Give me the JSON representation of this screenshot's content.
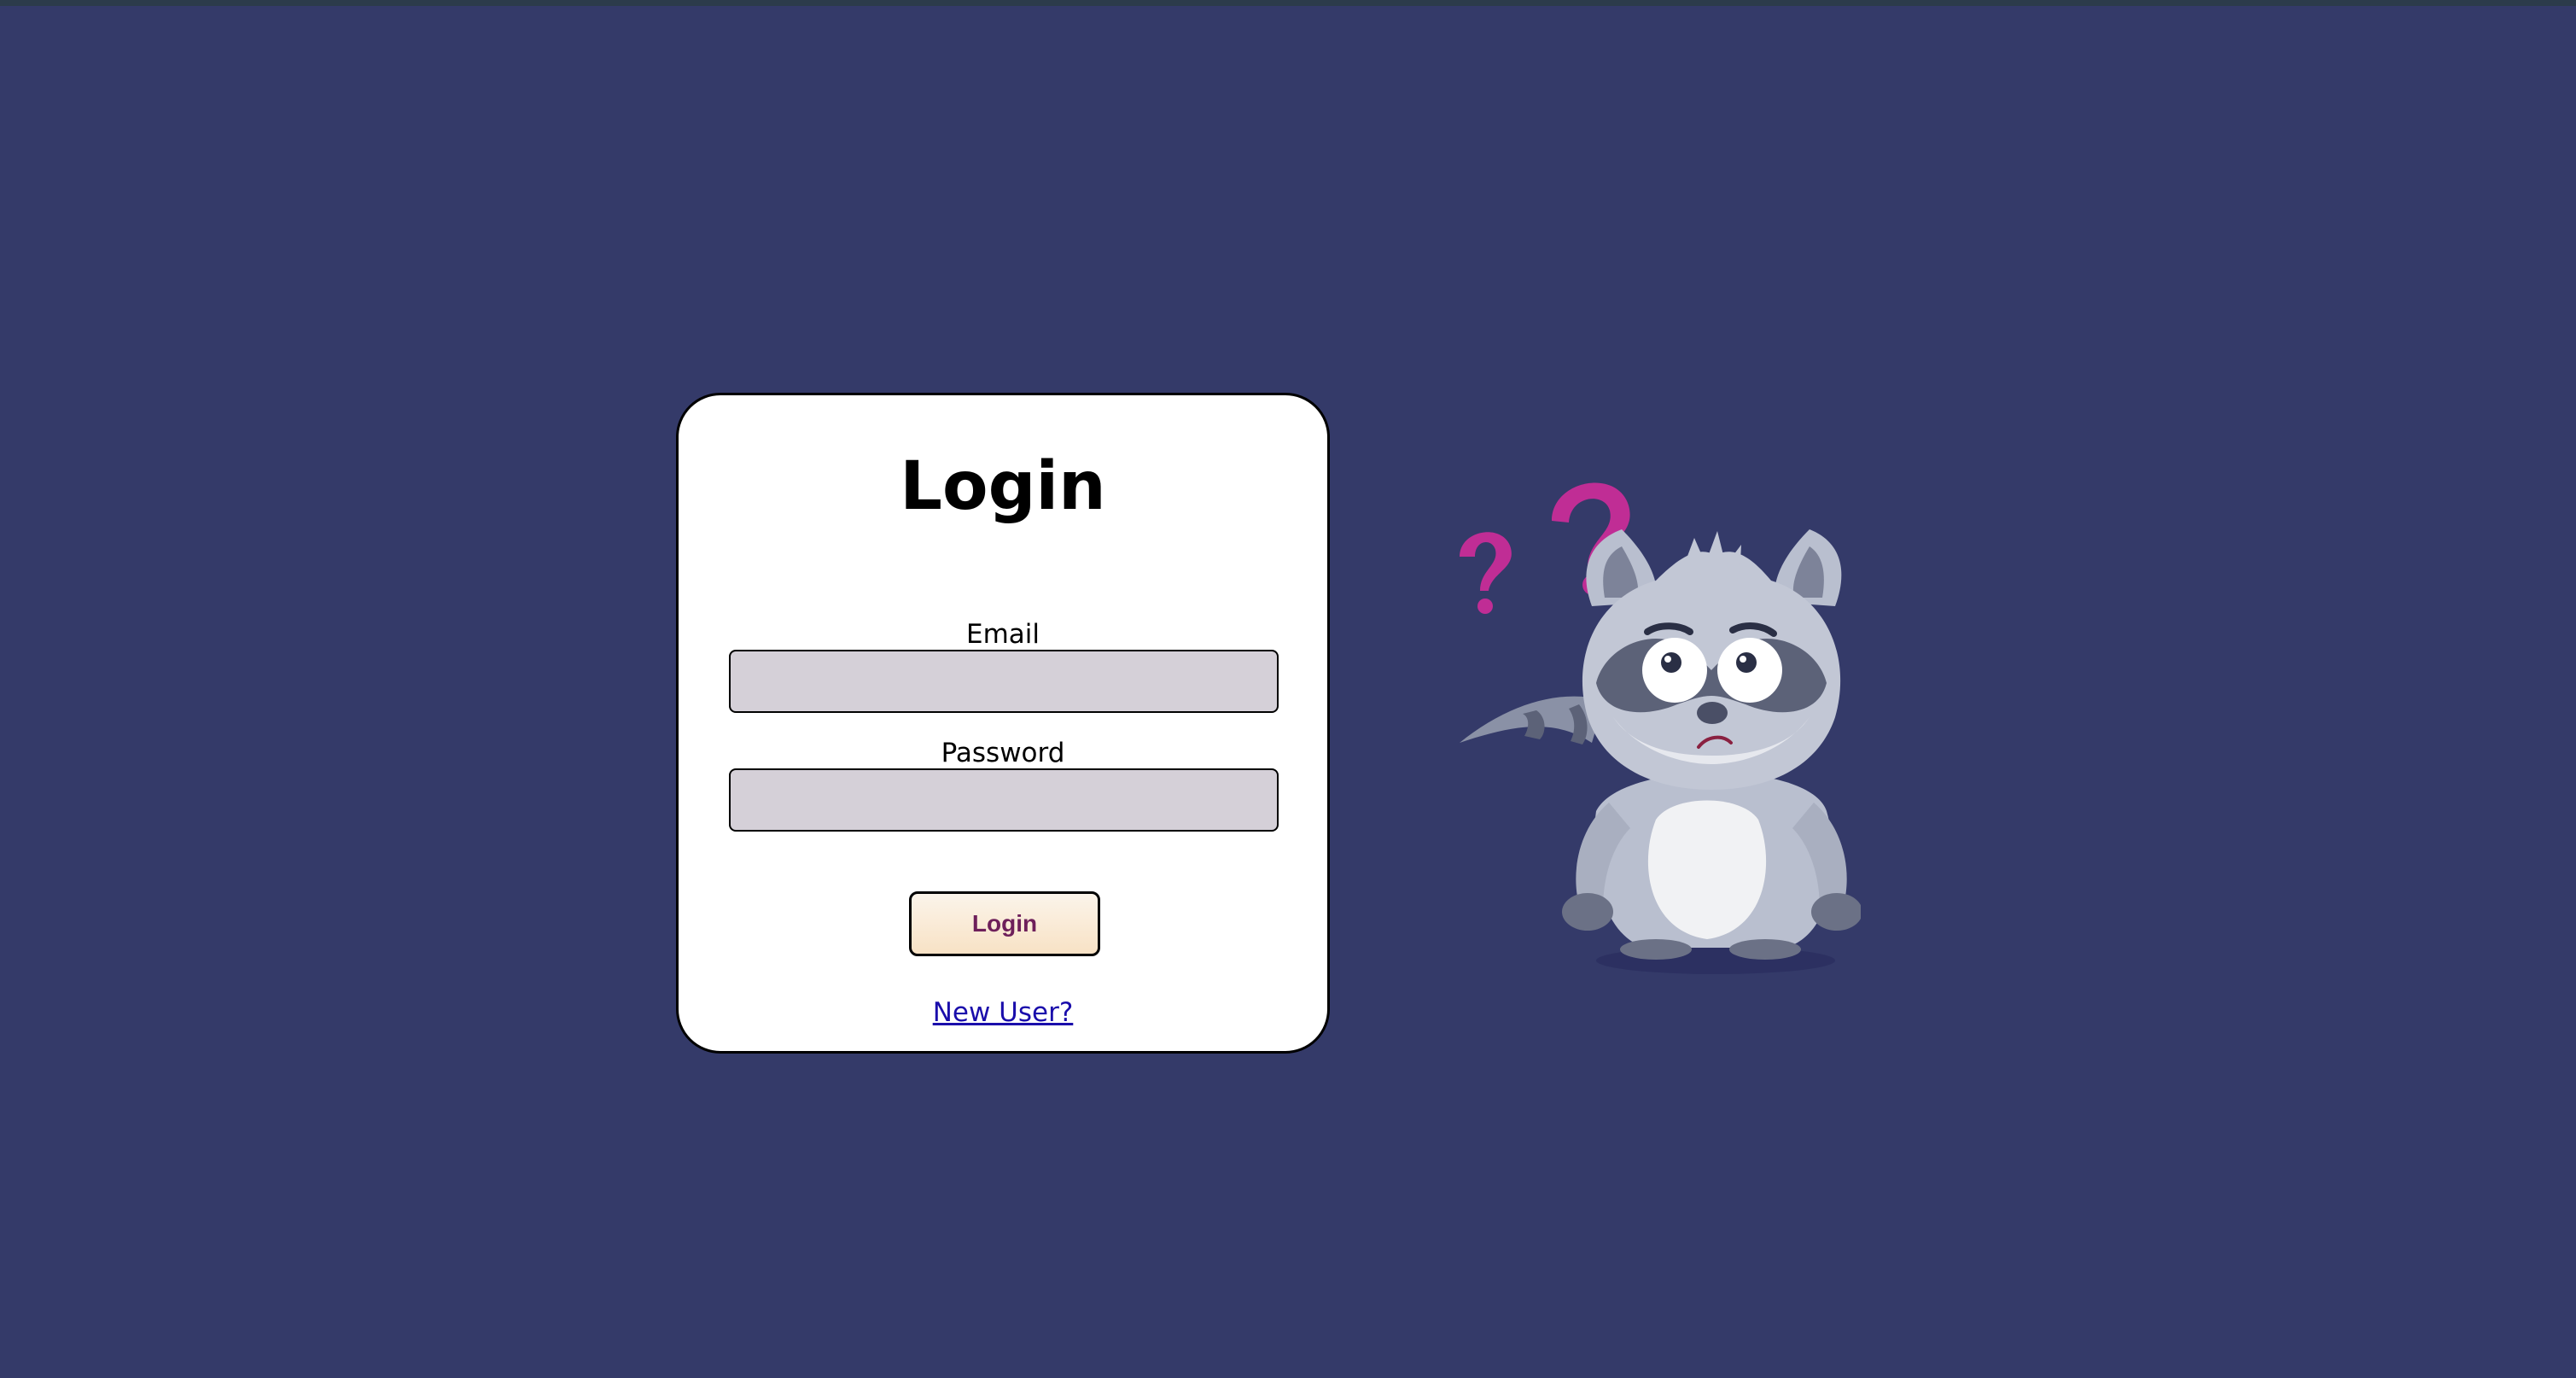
{
  "login_card": {
    "title": "Login",
    "email_label": "Email",
    "email_value": "",
    "password_label": "Password",
    "password_value": "",
    "submit_label": "Login",
    "signup_link": "New User?"
  },
  "mascot": {
    "icon": "confused-raccoon-icon",
    "question_mark_color": "#c02d95"
  },
  "colors": {
    "background": "#343a69",
    "card": "#ffffff",
    "input_fill": "#d5d0d8",
    "button_text": "#6e1f5a",
    "link": "#1a0dab"
  }
}
